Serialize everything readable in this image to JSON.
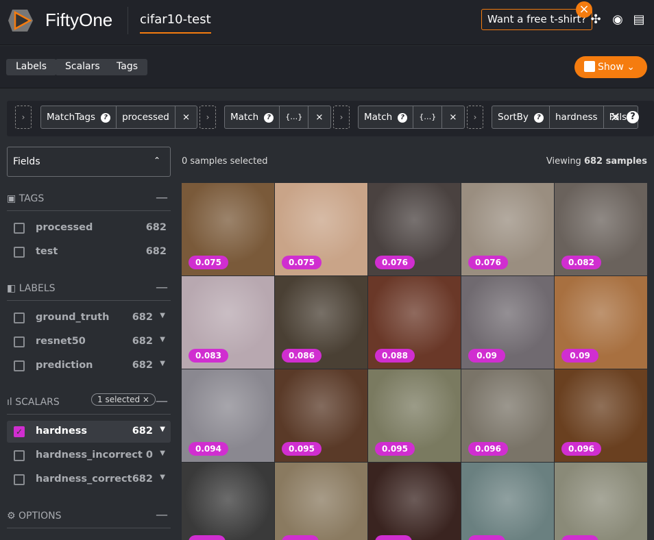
{
  "header": {
    "brand": "FiftyOne",
    "dataset": "cifar10-test",
    "promo": "Want a free t-shirt?"
  },
  "toolbar": {
    "labels": "Labels",
    "scalars": "Scalars",
    "tags": "Tags",
    "show": "Show"
  },
  "view_bar": {
    "stages": [
      {
        "name": "MatchTags",
        "params": [
          "processed"
        ]
      },
      {
        "name": "Match",
        "params": [
          "{…}"
        ]
      },
      {
        "name": "Match",
        "params": [
          "{…}"
        ]
      },
      {
        "name": "SortBy",
        "params": [
          "hardness",
          "False"
        ]
      }
    ]
  },
  "sidebar": {
    "fields_label": "Fields",
    "tags": {
      "title": "TAGS",
      "items": [
        {
          "label": "processed",
          "count": "682"
        },
        {
          "label": "test",
          "count": "682"
        }
      ]
    },
    "labels": {
      "title": "LABELS",
      "items": [
        {
          "label": "ground_truth",
          "count": "682"
        },
        {
          "label": "resnet50",
          "count": "682"
        },
        {
          "label": "prediction",
          "count": "682"
        }
      ]
    },
    "scalars": {
      "title": "SCALARS",
      "selected_pill": "1 selected ×",
      "items": [
        {
          "label": "hardness",
          "count": "682",
          "checked": true
        },
        {
          "label": "hardness_incorrect",
          "count": "0"
        },
        {
          "label": "hardness_correct",
          "count": "682"
        }
      ]
    },
    "options": {
      "title": "OPTIONS"
    }
  },
  "main": {
    "selected_text": "0 samples selected",
    "viewing_prefix": "Viewing ",
    "viewing_count": "682 samples",
    "tiles": [
      {
        "value": "0.075",
        "color": "#7a5a3a"
      },
      {
        "value": "0.075",
        "color": "#c9a488"
      },
      {
        "value": "0.076",
        "color": "#4a4240"
      },
      {
        "value": "0.076",
        "color": "#9a8e80"
      },
      {
        "value": "0.082",
        "color": "#6a625c"
      },
      {
        "value": "0.083",
        "color": "#b8a8b0"
      },
      {
        "value": "0.086",
        "color": "#4a4034"
      },
      {
        "value": "0.088",
        "color": "#6a3828"
      },
      {
        "value": "0.09",
        "color": "#706a70"
      },
      {
        "value": "0.09",
        "color": "#a87040"
      },
      {
        "value": "0.094",
        "color": "#8a8890"
      },
      {
        "value": "0.095",
        "color": "#5a3a28"
      },
      {
        "value": "0.095",
        "color": "#7a7a60"
      },
      {
        "value": "0.096",
        "color": "#7a7468"
      },
      {
        "value": "0.096",
        "color": "#6a4020"
      },
      {
        "value": "",
        "color": "#3a3a3a"
      },
      {
        "value": "",
        "color": "#8a7a60"
      },
      {
        "value": "",
        "color": "#3a2420"
      },
      {
        "value": "",
        "color": "#6a8080"
      },
      {
        "value": "",
        "color": "#8a8a78"
      }
    ]
  }
}
